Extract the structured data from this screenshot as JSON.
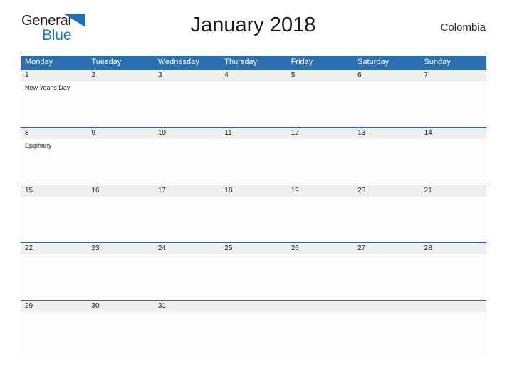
{
  "logo": {
    "word1": "General",
    "word2": "Blue",
    "flag_icon": "triangle-flag-icon",
    "word1_color": "#231f20",
    "word2_color": "#1478cd",
    "flag_color": "#1f6fb8"
  },
  "header": {
    "title": "January 2018",
    "country": "Colombia"
  },
  "colors": {
    "header_blue": "#2a6fb0",
    "row_divider_blue": "#2a6fb0",
    "date_band_gray": "#efefef",
    "cell_white": "#fdfdfd"
  },
  "calendar": {
    "weekdays": [
      "Monday",
      "Tuesday",
      "Wednesday",
      "Thursday",
      "Friday",
      "Saturday",
      "Sunday"
    ],
    "weeks": [
      {
        "dates": [
          "1",
          "2",
          "3",
          "4",
          "5",
          "6",
          "7"
        ],
        "events": [
          "New Year's Day",
          "",
          "",
          "",
          "",
          "",
          ""
        ]
      },
      {
        "dates": [
          "8",
          "9",
          "10",
          "11",
          "12",
          "13",
          "14"
        ],
        "events": [
          "Epiphany",
          "",
          "",
          "",
          "",
          "",
          ""
        ]
      },
      {
        "dates": [
          "15",
          "16",
          "17",
          "18",
          "19",
          "20",
          "21"
        ],
        "events": [
          "",
          "",
          "",
          "",
          "",
          "",
          ""
        ]
      },
      {
        "dates": [
          "22",
          "23",
          "24",
          "25",
          "26",
          "27",
          "28"
        ],
        "events": [
          "",
          "",
          "",
          "",
          "",
          "",
          ""
        ]
      },
      {
        "dates": [
          "29",
          "30",
          "31",
          "",
          "",
          "",
          ""
        ],
        "events": [
          "",
          "",
          "",
          "",
          "",
          "",
          ""
        ]
      }
    ]
  }
}
